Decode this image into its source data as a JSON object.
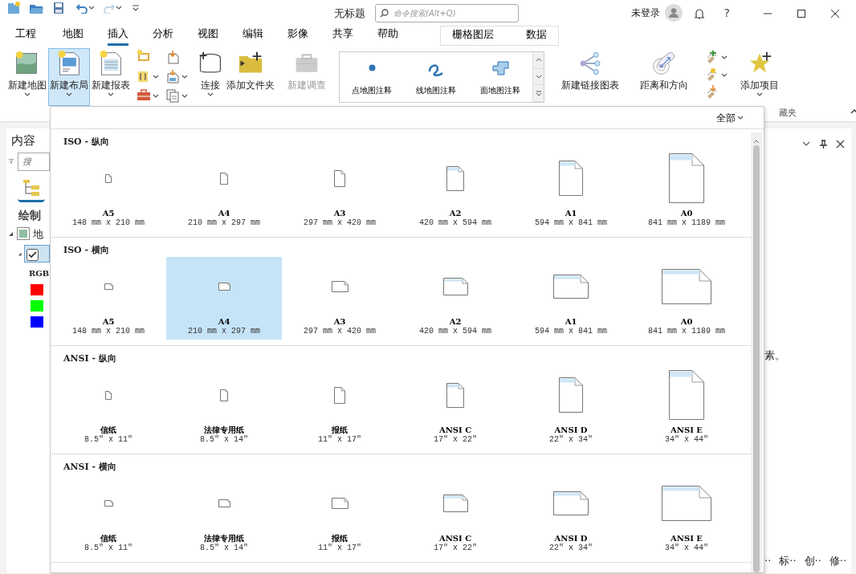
{
  "title_bar": {
    "title": "无标题",
    "search": {
      "placeholder": "命令搜索(Alt+Q)"
    },
    "user": "未登录",
    "help": "?"
  },
  "tabs": [
    {
      "label": "工程",
      "selected": false
    },
    {
      "label": "地图",
      "selected": false
    },
    {
      "label": "插入",
      "selected": true
    },
    {
      "label": "分析",
      "selected": false
    },
    {
      "label": "视图",
      "selected": false
    },
    {
      "label": "编辑",
      "selected": false
    },
    {
      "label": "影像",
      "selected": false
    },
    {
      "label": "共享",
      "selected": false
    },
    {
      "label": "帮助",
      "selected": false
    }
  ],
  "contextual_tabs": [
    {
      "label": "栅格图层",
      "selected": false
    },
    {
      "label": "数据",
      "selected": false
    }
  ],
  "ribbon": {
    "large_buttons": [
      {
        "label": "新建地图",
        "caret": true,
        "selected": false,
        "disabled": false
      },
      {
        "label": "新建布局",
        "caret": true,
        "selected": true,
        "disabled": false
      },
      {
        "label": "新建报表",
        "caret": true,
        "selected": false,
        "disabled": false
      },
      {
        "label": "连接",
        "caret": true,
        "selected": false,
        "disabled": false
      },
      {
        "label": "添加文件夹",
        "caret": false,
        "selected": false,
        "disabled": false
      },
      {
        "label": "新建调查",
        "caret": false,
        "selected": false,
        "disabled": true
      }
    ],
    "small_buttons": [
      {
        "caret": false
      },
      {
        "caret": true
      },
      {
        "caret": true
      },
      {
        "caret": false
      },
      {
        "caret": true
      },
      {
        "caret": true
      }
    ],
    "gallery": [
      {
        "label": "点地图注释"
      },
      {
        "label": "线地图注释"
      },
      {
        "label": "面地图注释"
      }
    ],
    "tool_buttons": [
      {
        "label": "新建链接图表",
        "caret": false
      },
      {
        "label": "距离和方向",
        "caret": false
      }
    ],
    "side_buttons": [
      {
        "caret": true
      },
      {
        "caret": true
      },
      {
        "caret": false
      }
    ],
    "add_button": {
      "label": "添加项目",
      "caret": true
    },
    "group_label": "藏夹"
  },
  "contents_pane": {
    "title": "内容",
    "search": {
      "placeholder": "搜"
    },
    "heading": "绘制",
    "tree": [
      {
        "label": "地",
        "expanded": true,
        "children": [
          {
            "checked": true,
            "expanded": true,
            "selected": true,
            "band_label": "RGB",
            "bands": [
              {
                "color": "#ff0000"
              },
              {
                "color": "#00ff00"
              },
              {
                "color": "#0000ff"
              }
            ]
          }
        ]
      }
    ]
  },
  "right_pane": {
    "text": "素。",
    "bottom_tabs": [
      "··",
      "标··",
      "创··",
      "修··"
    ]
  },
  "layout_dropdown": {
    "filter": "全部",
    "sections": [
      {
        "title": "ISO - 纵向",
        "kind": "portrait",
        "items": [
          {
            "name": "A5",
            "size": "148 mm x 210 mm",
            "selected": false
          },
          {
            "name": "A4",
            "size": "210 mm x 297 mm",
            "selected": false
          },
          {
            "name": "A3",
            "size": "297 mm x 420 mm",
            "selected": false
          },
          {
            "name": "A2",
            "size": "420 mm x 594 mm",
            "selected": false
          },
          {
            "name": "A1",
            "size": "594 mm x 841 mm",
            "selected": false
          },
          {
            "name": "A0",
            "size": "841 mm x 1189 mm",
            "selected": false
          }
        ]
      },
      {
        "title": "ISO - 横向",
        "kind": "landscape",
        "items": [
          {
            "name": "A5",
            "size": "148 mm x 210 mm",
            "selected": false
          },
          {
            "name": "A4",
            "size": "210 mm x 297 mm",
            "selected": true
          },
          {
            "name": "A3",
            "size": "297 mm x 420 mm",
            "selected": false
          },
          {
            "name": "A2",
            "size": "420 mm x 594 mm",
            "selected": false
          },
          {
            "name": "A1",
            "size": "594 mm x 841 mm",
            "selected": false
          },
          {
            "name": "A0",
            "size": "841 mm x 1189 mm",
            "selected": false
          }
        ]
      },
      {
        "title": "ANSI - 纵向",
        "kind": "portrait",
        "items": [
          {
            "name": "信纸",
            "size": "8.5″ x 11″",
            "selected": false
          },
          {
            "name": "法律专用纸",
            "size": "8.5″ x 14″",
            "selected": false
          },
          {
            "name": "报纸",
            "size": "11″ x 17″",
            "selected": false
          },
          {
            "name": "ANSI C",
            "size": "17″ x 22″",
            "selected": false
          },
          {
            "name": "ANSI D",
            "size": "22″ x 34″",
            "selected": false
          },
          {
            "name": "ANSI E",
            "size": "34″ x 44″",
            "selected": false
          }
        ]
      },
      {
        "title": "ANSI - 横向",
        "kind": "landscape",
        "items": [
          {
            "name": "信纸",
            "size": "8.5″ x 11″",
            "selected": false
          },
          {
            "name": "法律专用纸",
            "size": "8.5″ x 14″",
            "selected": false
          },
          {
            "name": "报纸",
            "size": "11″ x 17″",
            "selected": false
          },
          {
            "name": "ANSI C",
            "size": "17″ x 22″",
            "selected": false
          },
          {
            "name": "ANSI D",
            "size": "22″ x 34″",
            "selected": false
          },
          {
            "name": "ANSI E",
            "size": "34″ x 44″",
            "selected": false
          }
        ]
      }
    ]
  }
}
